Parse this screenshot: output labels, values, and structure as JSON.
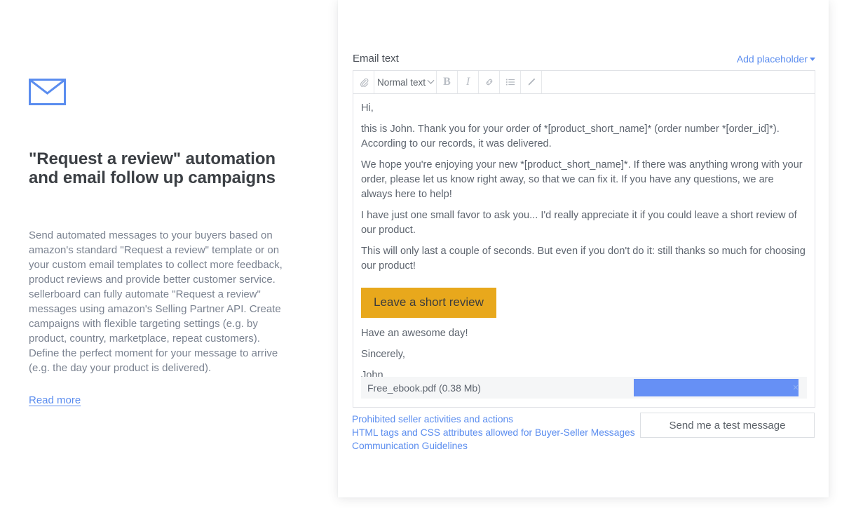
{
  "promo": {
    "icon": "envelope-icon",
    "title": "\"Request a review\" automation and email follow up campaigns",
    "body": "Send automated messages to your buyers based on amazon's standard \"Request a review\" template or on your custom email templates to collect more feedback, product reviews and provide better customer service. sellerboard can fully automate \"Request a review\" messages using amazon's Selling Partner API. Create campaigns with flexible targeting settings (e.g. by product, country, marketplace, repeat customers). Define the perfect moment for your message to arrive (e.g. the day your product is delivered).",
    "read_more": "Read more"
  },
  "editor": {
    "field_label": "Email text",
    "add_placeholder": "Add placeholder",
    "toolbar": {
      "attach": "📎",
      "style_value": "Normal text",
      "bold": "B",
      "italic": "I",
      "link": "link-icon",
      "list": "list-icon",
      "pencil": "pencil-icon"
    },
    "body": {
      "p1": "Hi,",
      "p2": "this is John. Thank you for your order of *[product_short_name]* (order number *[order_id]*). According to our records, it was delivered.",
      "p3": "We hope you're enjoying your new *[product_short_name]*. If there was anything wrong with your order, please let us know right away, so that we can fix it. If you have any questions, we are always here to help!",
      "p4": "I have just one small favor to ask you... I'd really appreciate it if you could leave a short review of our product.",
      "p5": "This will only last a couple of seconds. But even if you don't do it: still thanks so much for choosing our product!",
      "cta": "Leave a short review",
      "p6": "Have an awesome day!",
      "p7": "Sincerely,",
      "p8": "John"
    },
    "attachment": {
      "name": "Free_ebook.pdf (0.38 Mb)",
      "progress_percent": 100,
      "remove": "×"
    }
  },
  "footer": {
    "links": [
      "Prohibited seller activities and actions",
      "HTML tags and CSS attributes allowed for Buyer-Seller Messages",
      "Communication Guidelines"
    ],
    "test_button": "Send me a test message"
  },
  "colors": {
    "link": "#5b8def",
    "cta_background": "#e8a81c",
    "progress": "#6690f5",
    "heading": "#3b3f44",
    "body_text": "#7a8290"
  }
}
